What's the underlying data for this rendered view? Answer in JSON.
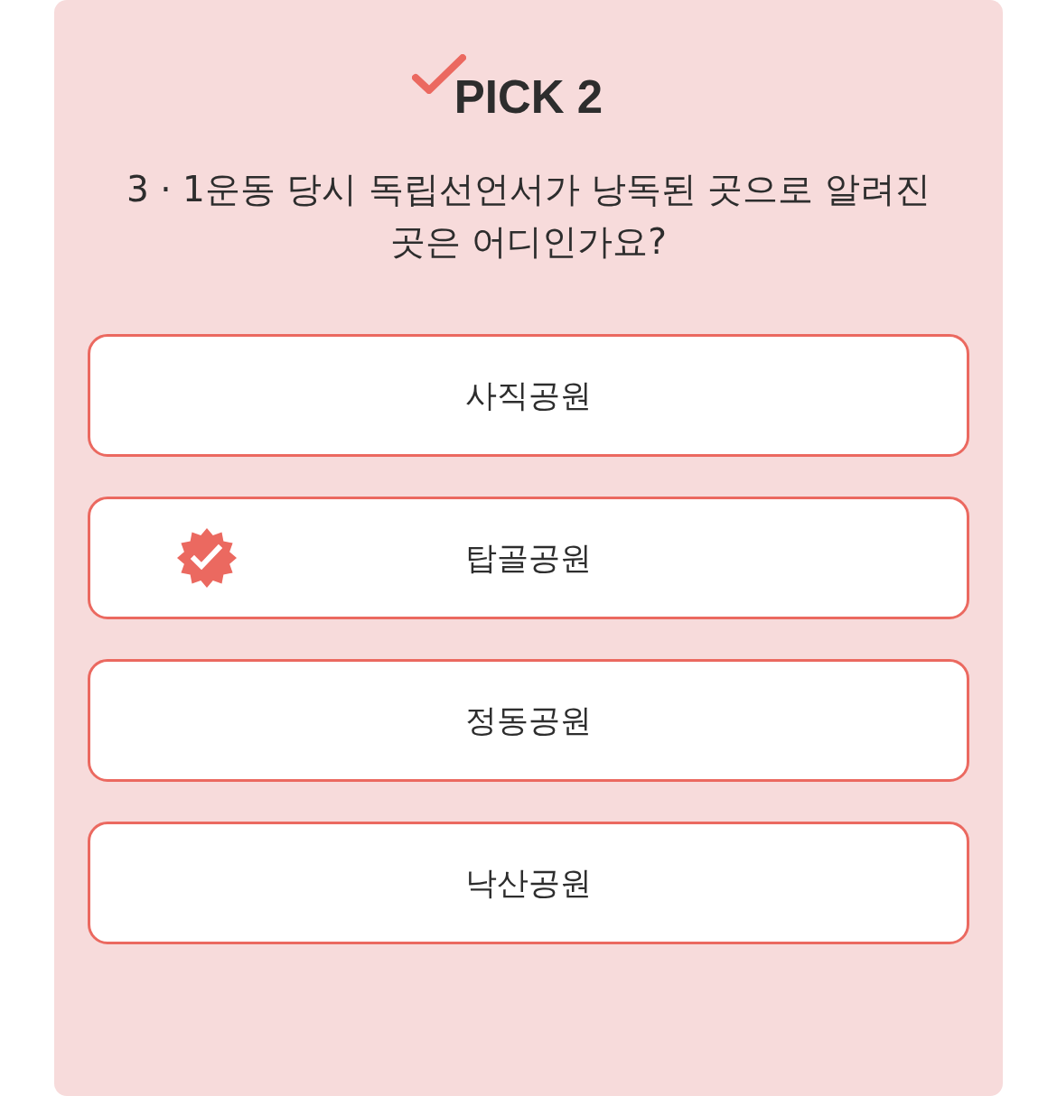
{
  "header": {
    "title": "PICK 2"
  },
  "question": "3 · 1운동 당시 독립선언서가 낭독된 곳으로 알려진 곳은 어디인가요?",
  "options": [
    {
      "label": "사직공원",
      "selected": false
    },
    {
      "label": "탑골공원",
      "selected": true
    },
    {
      "label": "정동공원",
      "selected": false
    },
    {
      "label": "낙산공원",
      "selected": false
    }
  ]
}
